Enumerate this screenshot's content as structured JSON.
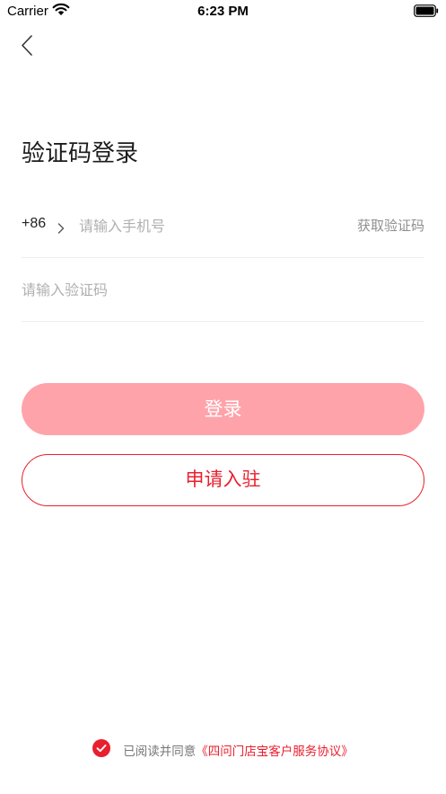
{
  "status_bar": {
    "carrier": "Carrier",
    "time": "6:23 PM"
  },
  "page": {
    "title": "验证码登录"
  },
  "phone": {
    "country_code": "+86",
    "placeholder": "请输入手机号",
    "get_code_label": "获取验证码"
  },
  "code": {
    "placeholder": "请输入验证码"
  },
  "buttons": {
    "login_label": "登录",
    "apply_label": "申请入驻"
  },
  "agreement": {
    "prefix": "已阅读并同意",
    "link": "《四问门店宝客户服务协议》",
    "checked": true
  },
  "colors": {
    "accent": "#e8202e",
    "login_button": "#ffa3ab",
    "placeholder": "#b0b0b0",
    "divider": "#ededed"
  },
  "icons": [
    "wifi-icon",
    "battery-icon",
    "back-arrow-icon",
    "chevron-right-icon",
    "check-circle-icon"
  ]
}
